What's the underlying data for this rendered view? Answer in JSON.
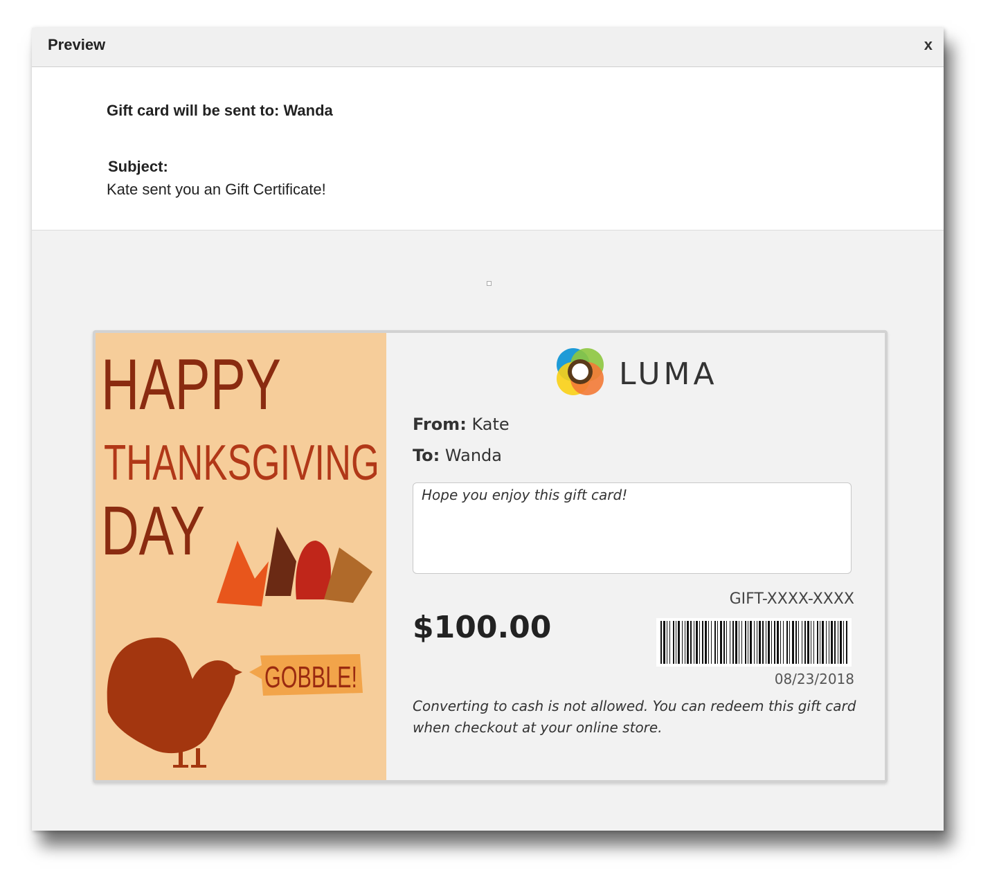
{
  "modal": {
    "title": "Preview",
    "close_label": "x"
  },
  "info": {
    "sent_to": "Gift card will be sent to: Wanda",
    "subject_label": "Subject:",
    "subject_text": "Kate sent you an Gift Certificate!"
  },
  "card": {
    "image": {
      "line1": "HAPPY",
      "line2": "THANKSGIVING",
      "line3": "DAY",
      "bubble": "GOBBLE!"
    },
    "brand": "LUMA",
    "from_label": "From:",
    "from_value": "Kate",
    "to_label": "To:",
    "to_value": "Wanda",
    "message": "Hope you enjoy this gift card!",
    "code": "GIFT-XXXX-XXXX",
    "amount": "$100.00",
    "date": "08/23/2018",
    "disclaimer": "Converting to cash is not allowed. You can redeem this gift card when checkout at your online store."
  },
  "colors": {
    "card_image_bg": "#f6cd9a",
    "turkey": "#a3360f",
    "card_bg": "#f2f2f2"
  }
}
